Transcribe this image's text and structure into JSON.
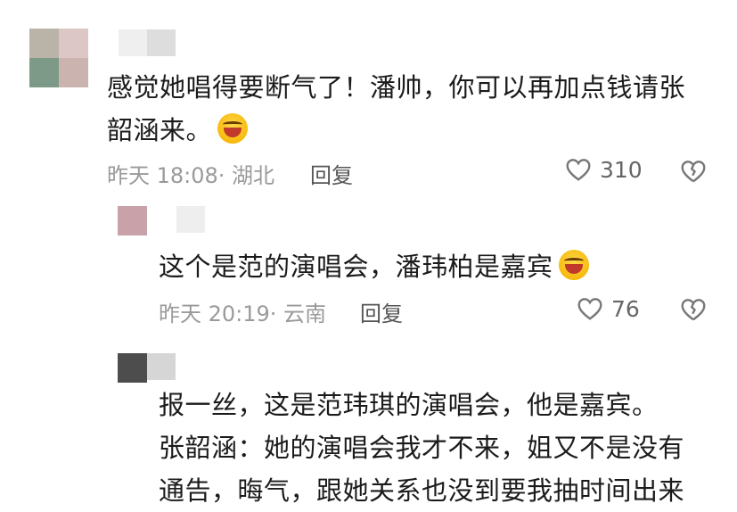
{
  "comments": [
    {
      "text_line1": "感觉她唱得要断气了！潘帅，你可以再加点钱请张",
      "text_line2": "韶涵来。",
      "emoji": "laughing-crying-emoji",
      "time": "昨天 18:08",
      "location": "· 湖北",
      "reply_label": "回复",
      "like_count": "310"
    },
    {
      "text": "这个是范的演唱会，潘玮柏是嘉宾",
      "emoji": "laughing-emoji",
      "time": "昨天 20:19",
      "location": "· 云南",
      "reply_label": "回复",
      "like_count": "76"
    },
    {
      "text_line1": "报一丝，这是范玮琪的演唱会，他是嘉宾。",
      "text_line2": "张韶涵：她的演唱会我才不来，姐又不是没有",
      "text_line3": "通告，晦气，跟她关系也没到要我抽时间出来"
    }
  ],
  "colors": {
    "text": "#1b1b1b",
    "meta": "#9a9a9a",
    "reply": "#555555",
    "icon": "#777777"
  },
  "icons": [
    "heart-outline-icon",
    "broken-heart-icon"
  ]
}
